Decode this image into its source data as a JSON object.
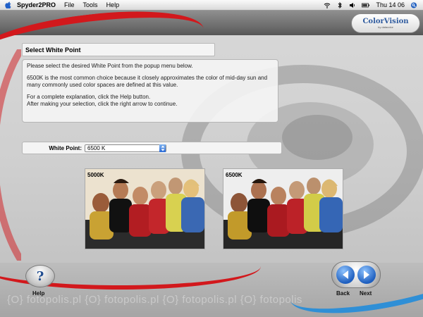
{
  "menubar": {
    "app_name": "Spyder2PRO",
    "menus": [
      "File",
      "Tools",
      "Help"
    ],
    "clock": "Thu 14 06"
  },
  "logo": {
    "brand": "ColorVision",
    "byline": "by datacolor"
  },
  "page": {
    "title": "Select White Point",
    "info": {
      "p1": "Please select the desired White Point from the popup menu below.",
      "p2": "6500K is the most common choice because it closely approximates the color of mid-day sun and many commonly used color spaces are defined at this value.",
      "p3a": "For a complete explanation, click the Help button.",
      "p3b": "After making your selection, click the right arrow to continue."
    },
    "white_point": {
      "label": "White Point:",
      "selected": "6500 K"
    },
    "previews": [
      {
        "label": "5000K"
      },
      {
        "label": "6500K"
      }
    ]
  },
  "buttons": {
    "help": "Help",
    "back": "Back",
    "next": "Next"
  },
  "watermark": "{O} fotopolis.pl {O} fotopolis.pl {O} fotopolis.pl {O} fotopolis",
  "colors": {
    "accent_red": "#d2181c",
    "accent_blue": "#2f8fd6",
    "button_blue": "#1f5fbf"
  }
}
